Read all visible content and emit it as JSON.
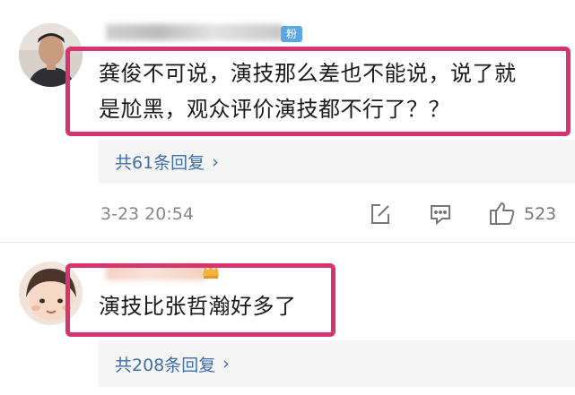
{
  "comments": [
    {
      "fan_badge": "粉",
      "text_line1": "龚俊不可说，演技那么差也不能说，说了就",
      "text_line2": "是尬黑，观众评价演技都不行了？？",
      "replies_label": "共61条回复",
      "timestamp": "3-23 20:54",
      "likes": "523"
    },
    {
      "text": "演技比张哲瀚好多了",
      "replies_label": "共208条回复"
    }
  ],
  "icons": {
    "edit": "edit-icon",
    "reply": "comment-icon",
    "like": "thumbs-up-icon",
    "chevron": "chevron-right-icon",
    "crown": "crown-icon"
  },
  "colors": {
    "highlight": "#d7336f",
    "reply_link": "#3f6ea8",
    "fan_badge": "#5aa7e6"
  }
}
